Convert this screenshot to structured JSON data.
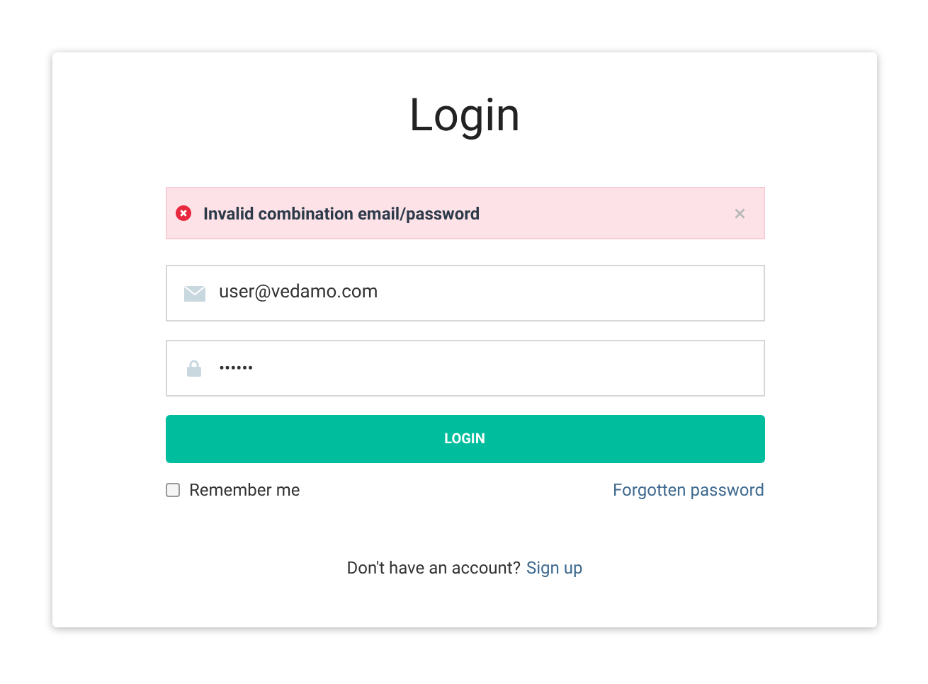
{
  "title": "Login",
  "alert": {
    "message": "Invalid combination email/password",
    "close": "×"
  },
  "email": {
    "value": "user@vedamo.com"
  },
  "password": {
    "value": "••••••"
  },
  "login_button": "LOGIN",
  "remember_me": {
    "label": "Remember me",
    "checked": false
  },
  "forgot_link": "Forgotten password",
  "signup": {
    "prompt": "Don't have an account?",
    "link": "Sign up"
  }
}
